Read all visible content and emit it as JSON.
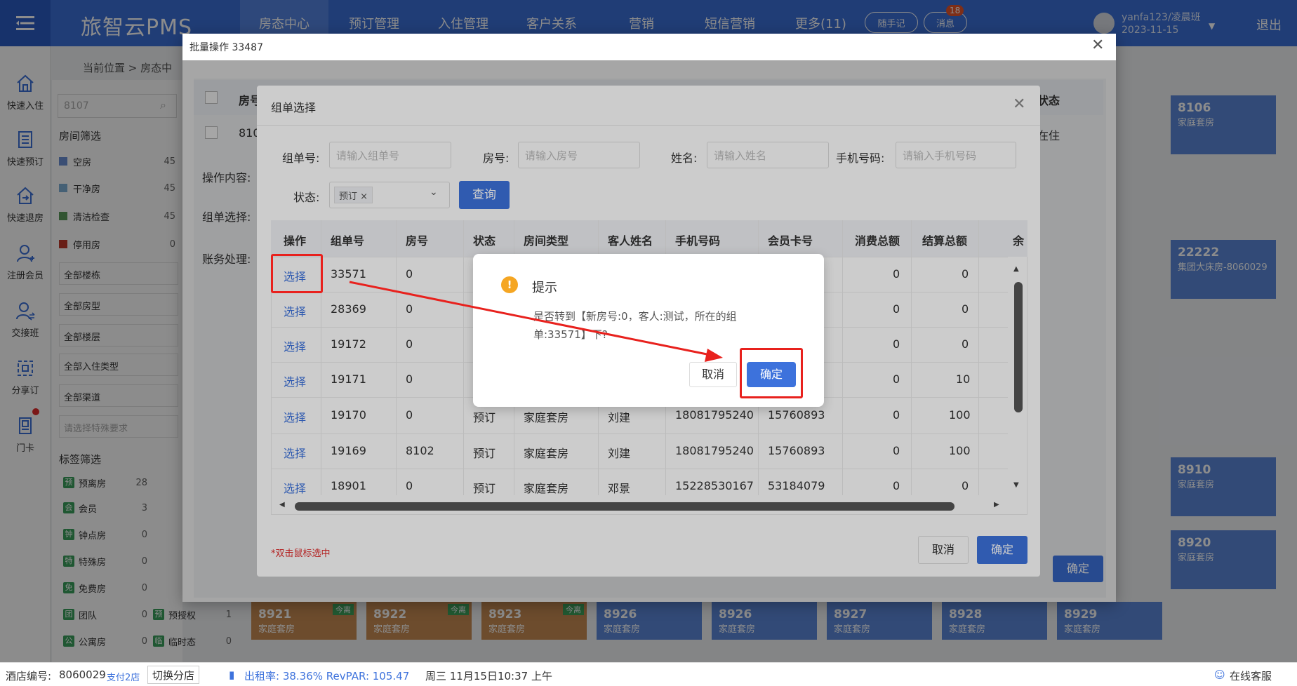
{
  "app": {
    "logo": "旅智云PMS",
    "nav_tabs": [
      "房态中心",
      "预订管理",
      "入住管理",
      "客户关系",
      "营销",
      "短信营销",
      "更多(11)"
    ],
    "pill_note": "随手记",
    "pill_msg": "消息",
    "msg_count": "18",
    "user_name": "yanfa123/凌晨班",
    "user_date": "2023-11-15",
    "logout": "退出"
  },
  "sidebar": [
    {
      "label": "快速入住",
      "icon": "home-icon"
    },
    {
      "label": "快速预订",
      "icon": "list-icon"
    },
    {
      "label": "快速退房",
      "icon": "checkout-icon"
    },
    {
      "label": "注册会员",
      "icon": "user-add-icon"
    },
    {
      "label": "交接班",
      "icon": "user-swap-icon"
    },
    {
      "label": "分享订",
      "icon": "share-icon"
    },
    {
      "label": "门卡",
      "icon": "card-icon"
    }
  ],
  "background": {
    "breadcrumb": "当前位置 > 房态中",
    "search_value": "8107",
    "room_filter_title": "房间筛选",
    "room_filters": [
      {
        "label": "空房",
        "count": "45",
        "color": "#6a8fd4"
      },
      {
        "label": "干净房",
        "count": "45",
        "color": "#7fb0d6"
      },
      {
        "label": "清洁检查",
        "count": "45",
        "color": "#5a9a5a"
      },
      {
        "label": "停用房",
        "count": "0",
        "color": "#c0392b"
      }
    ],
    "selects": [
      "全部楼栋",
      "全部房型",
      "全部楼层",
      "全部入住类型",
      "全部渠道",
      "请选择特殊要求"
    ],
    "tag_filter_title": "标签筛选",
    "tags": [
      {
        "icon": "预",
        "label": "预离房",
        "count": "28"
      },
      {
        "icon": "会",
        "label": "会员",
        "count": "3"
      },
      {
        "icon": "钟",
        "label": "钟点房",
        "count": "0"
      },
      {
        "icon": "特",
        "label": "特殊房",
        "count": "0"
      },
      {
        "icon": "免",
        "label": "免费房",
        "count": "0"
      },
      {
        "icon": "团",
        "label": "团队",
        "count": "0"
      },
      {
        "icon": "公",
        "label": "公寓房",
        "count": "0"
      }
    ],
    "tags2": [
      {
        "icon": "预",
        "label": "预授权",
        "count": "1"
      },
      {
        "icon": "临",
        "label": "临时态",
        "count": "0"
      }
    ],
    "rooms_right": [
      {
        "no": "8106",
        "type": "家庭套房",
        "color": "blue"
      },
      {
        "no": "22222",
        "type": "集团大床房-8060029",
        "color": "blue"
      },
      {
        "no": "8910",
        "type": "家庭套房",
        "color": "blue"
      },
      {
        "no": "8920",
        "type": "家庭套房",
        "color": "blue"
      }
    ],
    "rooms_bottom": [
      {
        "no": "8921",
        "type": "家庭套房",
        "color": "brown",
        "tag": "今离"
      },
      {
        "no": "8922",
        "type": "家庭套房",
        "color": "brown",
        "tag": "今离"
      },
      {
        "no": "8923",
        "type": "家庭套房",
        "color": "brown",
        "tag": "今离"
      },
      {
        "no": "8926",
        "type": "家庭套房",
        "color": "blue",
        "tag": ""
      },
      {
        "no": "8926",
        "type": "家庭套房",
        "color": "blue",
        "tag": ""
      },
      {
        "no": "8927",
        "type": "家庭套房",
        "color": "blue",
        "tag": ""
      },
      {
        "no": "8928",
        "type": "家庭套房",
        "color": "blue",
        "tag": ""
      },
      {
        "no": "8929",
        "type": "家庭套房",
        "color": "blue",
        "tag": ""
      }
    ]
  },
  "batch_dialog": {
    "title": "批量操作 33487",
    "head_room": "房号",
    "head_status": "状态",
    "row_room": "810",
    "row_status": "在住",
    "op_label": "操作内容:",
    "group_label": "组单选择:",
    "account_label": "账务处理:",
    "confirm": "确定"
  },
  "group_dialog": {
    "title": "组单选择",
    "filters": {
      "group_no_label": "组单号:",
      "group_no_placeholder": "请输入组单号",
      "room_label": "房号:",
      "room_placeholder": "请输入房号",
      "name_label": "姓名:",
      "name_placeholder": "请输入姓名",
      "phone_label": "手机号码:",
      "phone_placeholder": "请输入手机号码",
      "status_label": "状态:",
      "status_tag": "预订 ×",
      "query": "查询"
    },
    "columns": [
      "操作",
      "组单号",
      "房号",
      "状态",
      "房间类型",
      "客人姓名",
      "手机号码",
      "会员卡号",
      "消费总额",
      "结算总额",
      "余"
    ],
    "rows": [
      {
        "op": "选择",
        "group": "33571",
        "room": "0",
        "status": "",
        "type": "",
        "guest": "",
        "phone": "",
        "card": "",
        "spend": "0",
        "settle": "0"
      },
      {
        "op": "选择",
        "group": "28369",
        "room": "0",
        "status": "",
        "type": "",
        "guest": "",
        "phone": "",
        "card": "",
        "spend": "0",
        "settle": "0"
      },
      {
        "op": "选择",
        "group": "19172",
        "room": "0",
        "status": "",
        "type": "",
        "guest": "",
        "phone": "",
        "card": "",
        "spend": "0",
        "settle": "0"
      },
      {
        "op": "选择",
        "group": "19171",
        "room": "0",
        "status": "",
        "type": "",
        "guest": "",
        "phone": "",
        "card": "",
        "spend": "0",
        "settle": "10"
      },
      {
        "op": "选择",
        "group": "19170",
        "room": "0",
        "status": "预订",
        "type": "家庭套房",
        "guest": "刘建",
        "phone": "18081795240",
        "card": "15760893",
        "spend": "0",
        "settle": "100"
      },
      {
        "op": "选择",
        "group": "19169",
        "room": "8102",
        "status": "预订",
        "type": "家庭套房",
        "guest": "刘建",
        "phone": "18081795240",
        "card": "15760893",
        "spend": "0",
        "settle": "100"
      },
      {
        "op": "选择",
        "group": "18901",
        "room": "0",
        "status": "预订",
        "type": "家庭套房",
        "guest": "邓景",
        "phone": "15228530167",
        "card": "53184079",
        "spend": "0",
        "settle": "0"
      }
    ],
    "hint": "*双击鼠标选中",
    "cancel": "取消",
    "ok": "确定"
  },
  "confirm_dialog": {
    "title": "提示",
    "message": "是否转到【新房号:0，客人:测试，所在的组单:33571】下?",
    "cancel": "取消",
    "ok": "确定",
    "icon": "warning-icon"
  },
  "status_bar": {
    "store_label": "酒店编号:",
    "store_no": "8060029",
    "branches": "支付2店",
    "switch": "切换分店",
    "occupancy": "出租率: 38.36% RevPAR: 105.47",
    "datetime": "周三 11月15日10:37 上午",
    "service": "在线客服"
  },
  "colors": {
    "primary": "#3d72dc",
    "nav": "#3b6fd8",
    "annotation": "#e8211d",
    "warning": "#f5a623"
  }
}
